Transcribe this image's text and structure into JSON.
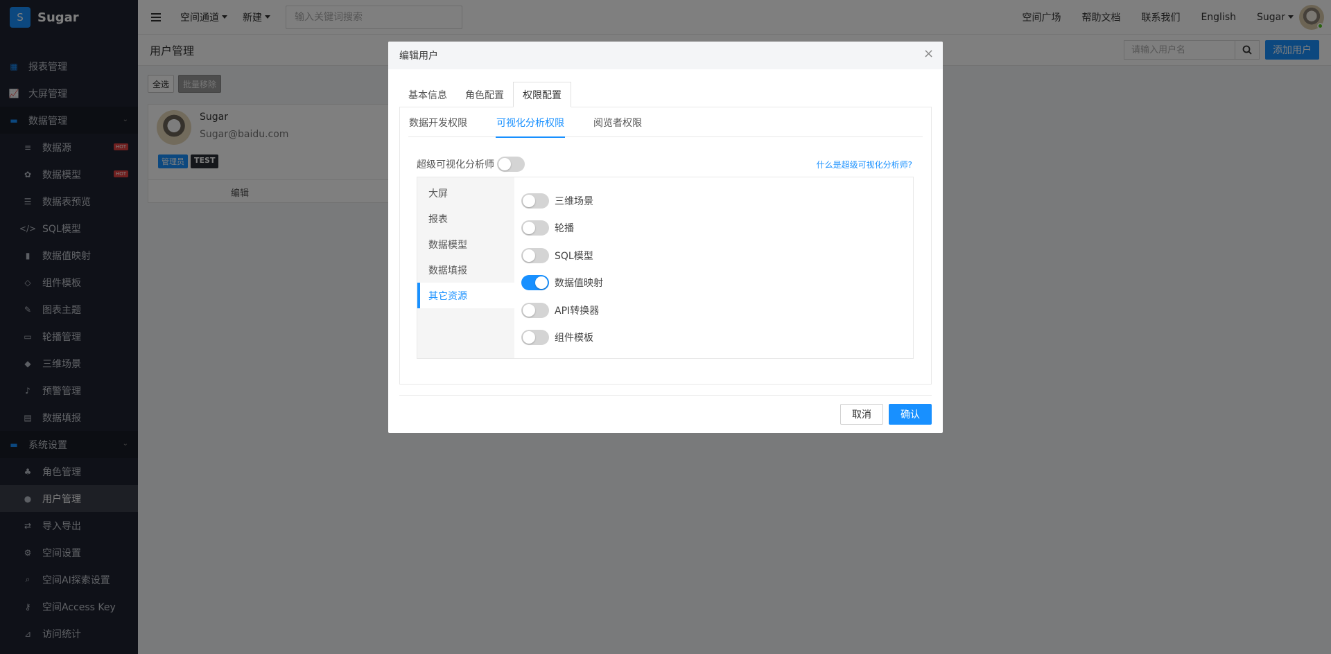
{
  "app": {
    "logo_letter": "S",
    "name": "Sugar"
  },
  "sidebar": {
    "items": [
      {
        "label": "报表管理",
        "icon": "grid-icon",
        "level": "top"
      },
      {
        "label": "大屏管理",
        "icon": "chart-line-icon",
        "level": "top"
      },
      {
        "label": "数据管理",
        "icon": "folder-icon",
        "level": "group"
      },
      {
        "label": "数据源",
        "icon": "database-icon",
        "level": "sub",
        "badge": "HOT"
      },
      {
        "label": "数据模型",
        "icon": "cubes-icon",
        "level": "sub",
        "badge": "HOT"
      },
      {
        "label": "数据表预览",
        "icon": "list-icon",
        "level": "sub"
      },
      {
        "label": "SQL模型",
        "icon": "code-icon",
        "level": "sub"
      },
      {
        "label": "数据值映射",
        "icon": "book-icon",
        "level": "sub"
      },
      {
        "label": "组件模板",
        "icon": "cube-outline-icon",
        "level": "sub"
      },
      {
        "label": "图表主题",
        "icon": "magic-wand-icon",
        "level": "sub"
      },
      {
        "label": "轮播管理",
        "icon": "monitor-icon",
        "level": "sub"
      },
      {
        "label": "三维场景",
        "icon": "cube-icon",
        "level": "sub"
      },
      {
        "label": "预警管理",
        "icon": "bell-icon",
        "level": "sub"
      },
      {
        "label": "数据填报",
        "icon": "id-card-icon",
        "level": "sub"
      },
      {
        "label": "系统设置",
        "icon": "folder-icon",
        "level": "group"
      },
      {
        "label": "角色管理",
        "icon": "users-icon",
        "level": "sub"
      },
      {
        "label": "用户管理",
        "icon": "user-icon",
        "level": "sub",
        "active": true
      },
      {
        "label": "导入导出",
        "icon": "exchange-icon",
        "level": "sub"
      },
      {
        "label": "空间设置",
        "icon": "gear-icon",
        "level": "sub"
      },
      {
        "label": "空间AI探索设置",
        "icon": "search-icon",
        "level": "sub"
      },
      {
        "label": "空间Access Key",
        "icon": "key-icon",
        "level": "sub"
      },
      {
        "label": "访问统计",
        "icon": "chart-area-icon",
        "level": "sub"
      }
    ]
  },
  "topbar": {
    "space_channel": "空间通道",
    "create": "新建",
    "search_placeholder": "输入关键词搜索",
    "links": [
      "空间广场",
      "帮助文档",
      "联系我们",
      "English"
    ],
    "user": "Sugar"
  },
  "page": {
    "title": "用户管理",
    "user_search_placeholder": "请输入用户名",
    "add_user": "添加用户",
    "select_all": "全选",
    "batch_remove": "批量移除"
  },
  "user_card": {
    "name": "Sugar",
    "email": "Sugar@baidu.com",
    "tags": [
      "管理员",
      "TEST"
    ],
    "edit": "编辑"
  },
  "modal": {
    "title": "编辑用户",
    "tabs": [
      "基本信息",
      "角色配置",
      "权限配置"
    ],
    "active_tab": "权限配置",
    "subtabs": [
      "数据开发权限",
      "可视化分析权限",
      "阅览者权限"
    ],
    "active_subtab": "可视化分析权限",
    "super_label": "超级可视化分析师",
    "super_on": false,
    "help_link": "什么是超级可视化分析师?",
    "categories": [
      "大屏",
      "报表",
      "数据模型",
      "数据填报",
      "其它资源"
    ],
    "active_category": "其它资源",
    "permissions": [
      {
        "label": "三维场景",
        "on": false
      },
      {
        "label": "轮播",
        "on": false
      },
      {
        "label": "SQL模型",
        "on": false
      },
      {
        "label": "数据值映射",
        "on": true
      },
      {
        "label": "API转换器",
        "on": false
      },
      {
        "label": "组件模板",
        "on": false
      }
    ],
    "cancel": "取消",
    "confirm": "确认"
  },
  "colors": {
    "accent": "#1890ff",
    "sidebar_bg": "#1f2330",
    "hot_badge": "#e04040"
  }
}
